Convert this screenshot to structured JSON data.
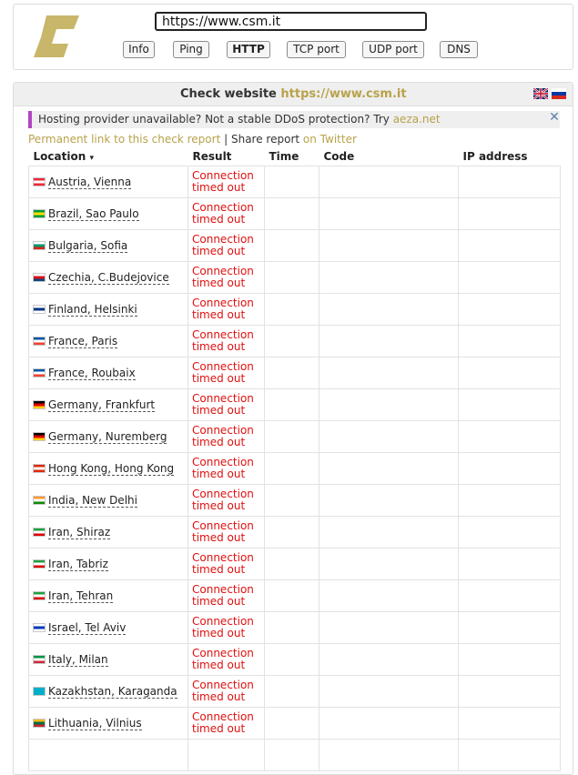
{
  "search": {
    "url": "https://www.csm.it"
  },
  "nav": {
    "buttons": [
      {
        "label": "Info",
        "active": false
      },
      {
        "label": "Ping",
        "active": false
      },
      {
        "label": "HTTP",
        "active": true
      },
      {
        "label": "TCP port",
        "active": false
      },
      {
        "label": "UDP port",
        "active": false
      },
      {
        "label": "DNS",
        "active": false
      }
    ]
  },
  "panel": {
    "title_prefix": "Check website",
    "title_url": "https://www.csm.it",
    "languages": [
      "english-flag-icon",
      "russian-flag-icon"
    ]
  },
  "promo": {
    "text": "Hosting provider unavailable? Not a stable DDoS protection? Try",
    "link": "aeza.net"
  },
  "links": {
    "permalink": "Permanent link to this check report",
    "separator": "|",
    "share": "Share report",
    "twitter": "on Twitter"
  },
  "table": {
    "headers": {
      "location": "Location",
      "sort": "▾",
      "result": "Result",
      "time": "Time",
      "code": "Code",
      "ip": "IP address"
    },
    "rows": [
      {
        "location": "Austria, Vienna",
        "flag": [
          "#ed2939",
          "#ffffff",
          "#ed2939"
        ],
        "result_1": "Connection",
        "result_2": "timed out"
      },
      {
        "location": "Brazil, Sao Paulo",
        "flag": [
          "#009c3b",
          "#ffdf00",
          "#009c3b"
        ],
        "result_1": "Connection",
        "result_2": "timed out"
      },
      {
        "location": "Bulgaria, Sofia",
        "flag": [
          "#ffffff",
          "#00966e",
          "#d62612"
        ],
        "result_1": "Connection",
        "result_2": "timed out"
      },
      {
        "location": "Czechia, C.Budejovice",
        "flag": [
          "#ffffff",
          "#d7141a",
          "#11457e"
        ],
        "result_1": "Connection",
        "result_2": "timed out"
      },
      {
        "location": "Finland, Helsinki",
        "flag": [
          "#ffffff",
          "#003580",
          "#ffffff"
        ],
        "result_1": "Connection",
        "result_2": "timed out"
      },
      {
        "location": "France, Paris",
        "flag": [
          "#0055a4",
          "#ffffff",
          "#ef4135"
        ],
        "result_1": "Connection",
        "result_2": "timed out"
      },
      {
        "location": "France, Roubaix",
        "flag": [
          "#0055a4",
          "#ffffff",
          "#ef4135"
        ],
        "result_1": "Connection",
        "result_2": "timed out"
      },
      {
        "location": "Germany, Frankfurt",
        "flag": [
          "#000000",
          "#dd0000",
          "#ffce00"
        ],
        "result_1": "Connection",
        "result_2": "timed out"
      },
      {
        "location": "Germany, Nuremberg",
        "flag": [
          "#000000",
          "#dd0000",
          "#ffce00"
        ],
        "result_1": "Connection",
        "result_2": "timed out"
      },
      {
        "location": "Hong Kong, Hong Kong",
        "flag": [
          "#de2910",
          "#ffffff",
          "#de2910"
        ],
        "result_1": "Connection",
        "result_2": "timed out"
      },
      {
        "location": "India, New Delhi",
        "flag": [
          "#ff9933",
          "#ffffff",
          "#138808"
        ],
        "result_1": "Connection",
        "result_2": "timed out"
      },
      {
        "location": "Iran, Shiraz",
        "flag": [
          "#239f40",
          "#ffffff",
          "#da0000"
        ],
        "result_1": "Connection",
        "result_2": "timed out"
      },
      {
        "location": "Iran, Tabriz",
        "flag": [
          "#239f40",
          "#ffffff",
          "#da0000"
        ],
        "result_1": "Connection",
        "result_2": "timed out"
      },
      {
        "location": "Iran, Tehran",
        "flag": [
          "#239f40",
          "#ffffff",
          "#da0000"
        ],
        "result_1": "Connection",
        "result_2": "timed out"
      },
      {
        "location": "Israel, Tel Aviv",
        "flag": [
          "#ffffff",
          "#0038b8",
          "#ffffff"
        ],
        "result_1": "Connection",
        "result_2": "timed out"
      },
      {
        "location": "Italy, Milan",
        "flag": [
          "#009246",
          "#ffffff",
          "#ce2b37"
        ],
        "result_1": "Connection",
        "result_2": "timed out"
      },
      {
        "location": "Kazakhstan, Karaganda",
        "flag": [
          "#00afca",
          "#00afca",
          "#00afca"
        ],
        "result_1": "Connection",
        "result_2": "timed out"
      },
      {
        "location": "Lithuania, Vilnius",
        "flag": [
          "#fdb913",
          "#006a44",
          "#c1272d"
        ],
        "result_1": "Connection",
        "result_2": "timed out"
      },
      {
        "location": "",
        "flag": [
          "#ffffff",
          "#ffffff",
          "#ffffff"
        ],
        "result_1": "",
        "result_2": ""
      }
    ]
  },
  "colors": {
    "accent": "#b8a24a",
    "error": "#e01010",
    "promo_bar": "#b146c2"
  }
}
